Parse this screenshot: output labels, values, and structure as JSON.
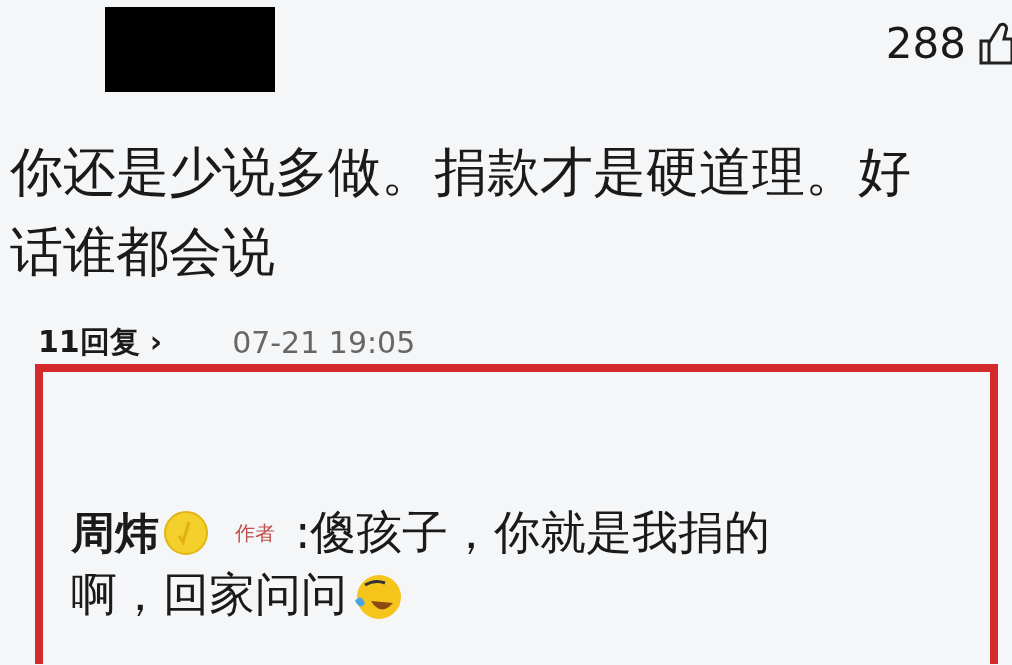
{
  "header": {
    "like_count": "288"
  },
  "comment": {
    "lines": [
      "你还是少说多做。捐款才是硬道理。好",
      "话谁都会说"
    ]
  },
  "meta": {
    "replies": "11回复",
    "chevron": "›",
    "time": "07-21 19:05"
  },
  "highlight": {
    "color": "#d42a2a"
  },
  "reply": {
    "author": "周炜",
    "verified": true,
    "tag": "作者",
    "lines": [
      ":傻孩子，你就是我捐的",
      "啊，回家问问"
    ]
  }
}
